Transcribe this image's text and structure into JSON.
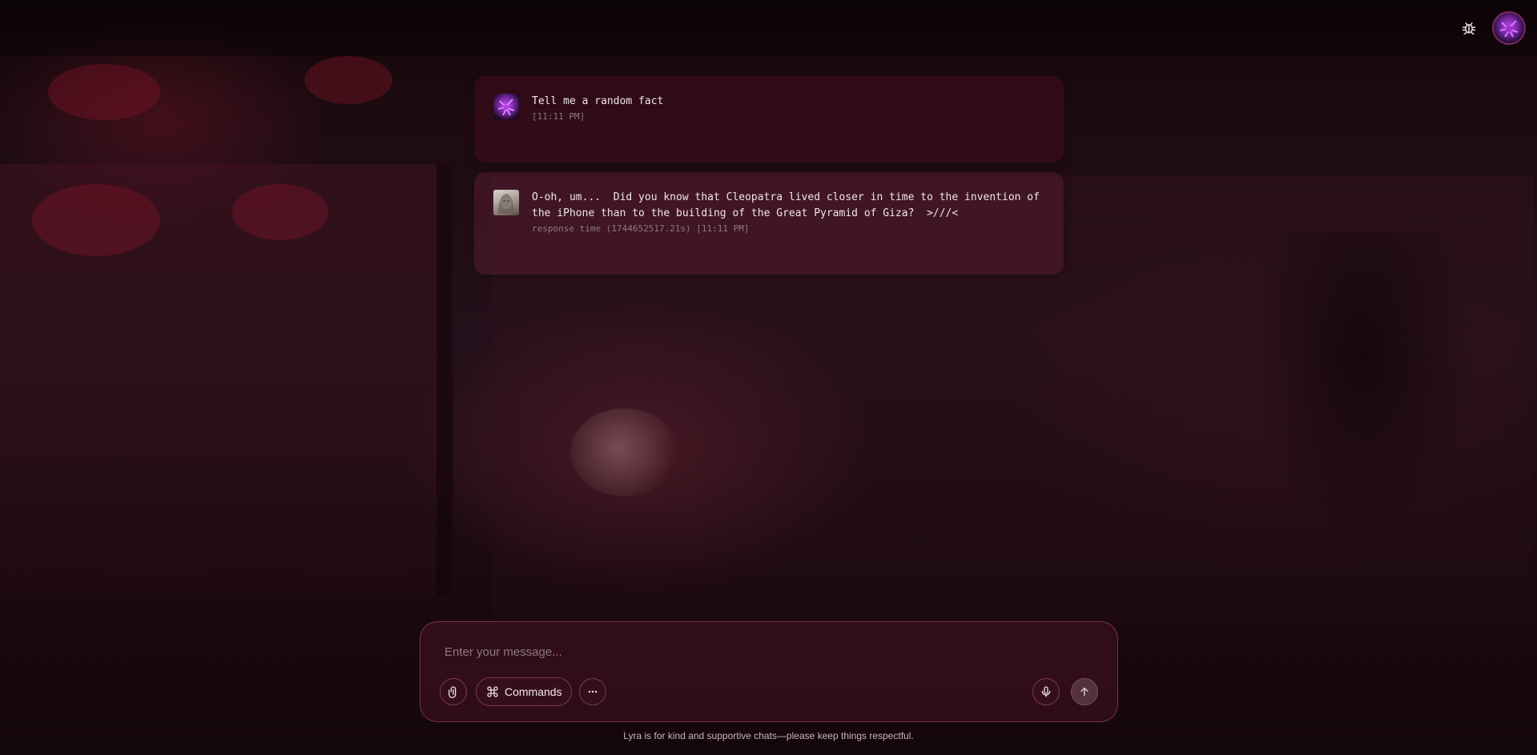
{
  "header": {
    "debug_icon": "bug-icon",
    "profile_icon": "user-avatar"
  },
  "messages": [
    {
      "role": "user",
      "text": "Tell me a random fact",
      "meta": "[11:11 PM]"
    },
    {
      "role": "assistant",
      "text": "O-oh, um...  Did you know that Cleopatra lived closer in time to the invention of\nthe iPhone than to the building of the Great Pyramid of Giza?  >///<",
      "meta": "response time (1744652517.21s) [11:11 PM]"
    }
  ],
  "composer": {
    "placeholder": "Enter your message...",
    "value": "",
    "commands_label": "Commands",
    "attach_icon": "paperclip-icon",
    "commands_icon": "command-icon",
    "more_icon": "more-icon",
    "mic_icon": "microphone-icon",
    "send_icon": "arrow-up-icon"
  },
  "footer": {
    "note": "Lyra is for kind and supportive chats—please keep things respectful."
  },
  "colors": {
    "background": "#1a0a10",
    "bubble_user": "#3c0c1c",
    "bubble_bot": "#551c30",
    "text": "#efe6ea",
    "muted": "#8c7880",
    "border": "#aa5a6e"
  }
}
